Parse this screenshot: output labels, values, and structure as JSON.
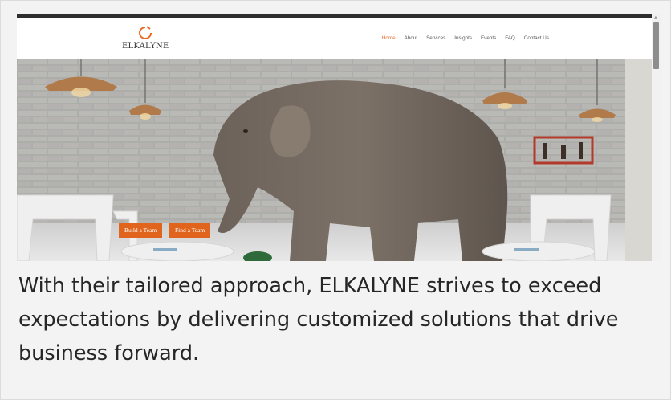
{
  "brand": {
    "name": "ELKALYNE",
    "logo_icon": "elkalyne-logo-icon",
    "accent": "#e86a25"
  },
  "nav": {
    "items": [
      {
        "label": "Home",
        "active": true
      },
      {
        "label": "About",
        "active": false
      },
      {
        "label": "Services",
        "active": false
      },
      {
        "label": "Insights",
        "active": false
      },
      {
        "label": "Events",
        "active": false
      },
      {
        "label": "FAQ",
        "active": false
      },
      {
        "label": "Contact Us",
        "active": false
      }
    ]
  },
  "hero": {
    "image": "elephant-in-restaurant-photo",
    "buttons": [
      {
        "label": "Build a Team"
      },
      {
        "label": "Find a Team"
      }
    ],
    "button_color": "#e0641c"
  },
  "caption": {
    "text": "With their tailored approach, ELKALYNE strives to exceed expectations by delivering customized solutions that drive business forward."
  },
  "scrollbar": {
    "up_icon": "scroll-up-arrow-icon"
  }
}
